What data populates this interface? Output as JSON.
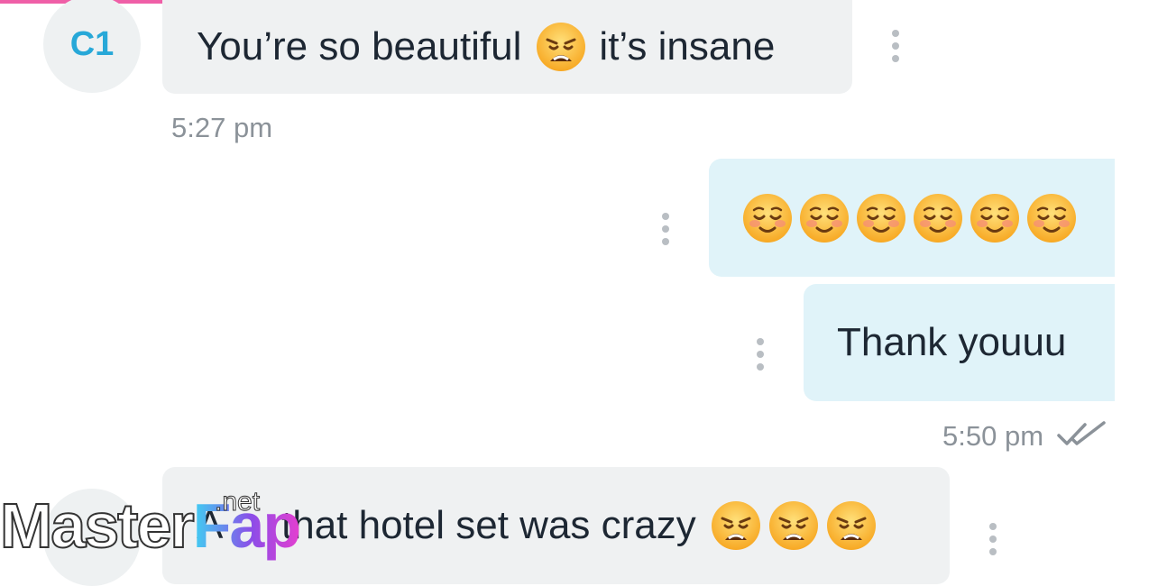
{
  "messages": [
    {
      "direction": "incoming",
      "avatar_initials": "C1",
      "text_before": "You’re so beautiful",
      "emoji": [
        "weary-face"
      ],
      "text_after": "it’s insane",
      "timestamp": "5:27 pm"
    },
    {
      "direction": "outgoing",
      "emoji": [
        "smiling-face",
        "smiling-face",
        "smiling-face",
        "smiling-face",
        "smiling-face",
        "smiling-face"
      ]
    },
    {
      "direction": "outgoing",
      "text": "Thank youuu",
      "timestamp": "5:50 pm",
      "status": "read"
    },
    {
      "direction": "incoming",
      "text_partial": "A",
      "text": "that hotel set was crazy",
      "emoji": [
        "weary-face",
        "weary-face",
        "weary-face"
      ]
    }
  ],
  "watermark": {
    "part1": "Master",
    "part2": "Fap",
    "suffix": ".net"
  },
  "colors": {
    "accent": "#ef5fa7",
    "avatar_text": "#27a8d8",
    "incoming_bubble": "#eff1f2",
    "outgoing_bubble": "#e0f3f9",
    "timestamp": "#8b9299",
    "read_ticks": "#8b9299"
  },
  "icons": {
    "menu": "vertical-ellipsis-icon",
    "read_receipt": "double-check-icon",
    "emoji_weary": "weary-face-icon",
    "emoji_smiling": "smiling-face-icon"
  }
}
